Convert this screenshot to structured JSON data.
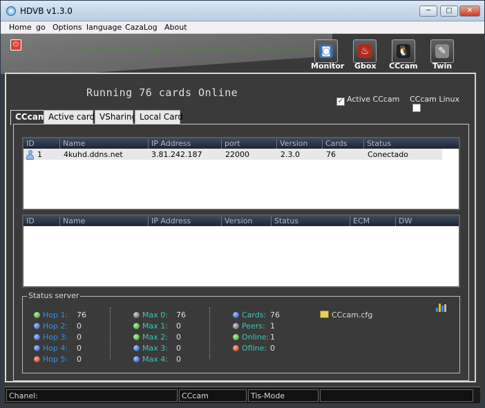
{
  "window": {
    "title": "HDVB v1.3.0",
    "min": "─",
    "max": "□",
    "close": "✕"
  },
  "menu": [
    "Home",
    "go",
    "Options",
    "language",
    "CazaLog",
    "About"
  ],
  "toolbar": [
    {
      "label": "Monitor",
      "icon": "◙"
    },
    {
      "label": "Gbox",
      "icon": "♨"
    },
    {
      "label": "CCcam",
      "icon": "🐧"
    },
    {
      "label": "Twin",
      "icon": "✎"
    }
  ],
  "ghost": {
    "ms": "164 ms",
    "ticker": "el SKY DEUTSCHLAND - SKY SPORT HD SERVIDOR: CPdkulDK / Hora de la web / 01s"
  },
  "running": "Running 76 cards Online",
  "active_cccam": {
    "label": "Active CCcam",
    "checked": "✓"
  },
  "cccam_linux": {
    "label": "CCcam Linux",
    "checked": ""
  },
  "tabs": [
    "CCcam",
    "Active cards",
    "VSharing",
    "Local Card"
  ],
  "servers": {
    "columns": [
      "ID",
      "Name",
      "IP Address",
      "port",
      "Version",
      "Cards",
      "Status"
    ],
    "rows": [
      {
        "id": "1",
        "name": "4kuhd.ddns.net",
        "ip": "3.81.242.187",
        "port": "22000",
        "version": "2.3.0",
        "cards": "76",
        "status": "Conectado"
      }
    ]
  },
  "clients": {
    "columns": [
      "ID",
      "Name",
      "IP Address",
      "Version",
      "Status",
      "ECM",
      "DW"
    ]
  },
  "status_server": {
    "legend": "Status server",
    "hops": [
      {
        "label": "Hop 1:",
        "value": "76",
        "color": "g"
      },
      {
        "label": "Hop 2:",
        "value": "0",
        "color": "b"
      },
      {
        "label": "Hop 3:",
        "value": "0",
        "color": "b"
      },
      {
        "label": "Hop 4:",
        "value": "0",
        "color": "b"
      },
      {
        "label": "Hop 5:",
        "value": "0",
        "color": "r"
      }
    ],
    "max": [
      {
        "label": "Max 0:",
        "value": "76",
        "color": "gy"
      },
      {
        "label": "Max 1:",
        "value": "0",
        "color": "g"
      },
      {
        "label": "Max 2:",
        "value": "0",
        "color": "g"
      },
      {
        "label": "Max 3:",
        "value": "0",
        "color": "b"
      },
      {
        "label": "Max 4:",
        "value": "0",
        "color": "b"
      }
    ],
    "totals": [
      {
        "label": "Cards:",
        "value": "76",
        "color": "b"
      },
      {
        "label": "Peers:",
        "value": "1",
        "color": "gy"
      },
      {
        "label": "Online:",
        "value": "1",
        "color": "g"
      },
      {
        "label": "Ofline:",
        "value": "0",
        "color": "r"
      }
    ],
    "cfg_file": "CCcam.cfg"
  },
  "statusbar": [
    "Chanel:",
    "CCcam",
    "Tis-Mode",
    ""
  ]
}
